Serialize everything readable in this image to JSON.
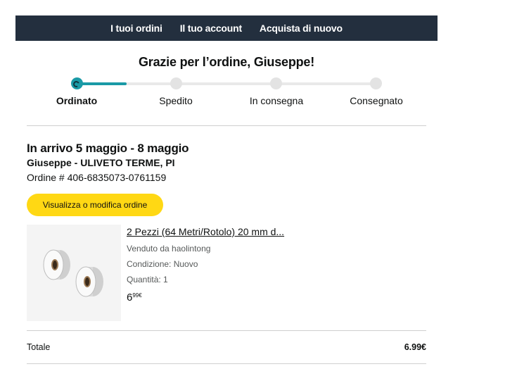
{
  "nav": {
    "orders": "I tuoi ordini",
    "account": "Il tuo account",
    "buy_again": "Acquista di nuovo"
  },
  "title": "Grazie per l’ordine, Giuseppe!",
  "tracker": {
    "steps": [
      "Ordinato",
      "Spedito",
      "In consegna",
      "Consegnato"
    ],
    "active_index": 0,
    "colors": {
      "active": "#1a9aa6",
      "inactive": "#e3e3e3"
    }
  },
  "order": {
    "arrival": "In arrivo 5 maggio - 8 maggio",
    "address": "Giuseppe - ULIVETO TERME, PI",
    "number": "Ordine # 406-6835073-0761159",
    "button": "Visualizza o modifica ordine"
  },
  "product": {
    "title": "2 Pezzi (64 Metri/Rotolo) 20 mm d...",
    "seller": "Venduto da haolintong",
    "condition": "Condizione: Nuovo",
    "quantity": "Quantità: 1",
    "price_whole": "6",
    "price_fraction": "99€"
  },
  "total": {
    "label": "Totale",
    "value": "6.99€"
  },
  "colors": {
    "nav_bg": "#232f3e",
    "button_bg": "#ffd814",
    "accent": "#1a9aa6"
  }
}
